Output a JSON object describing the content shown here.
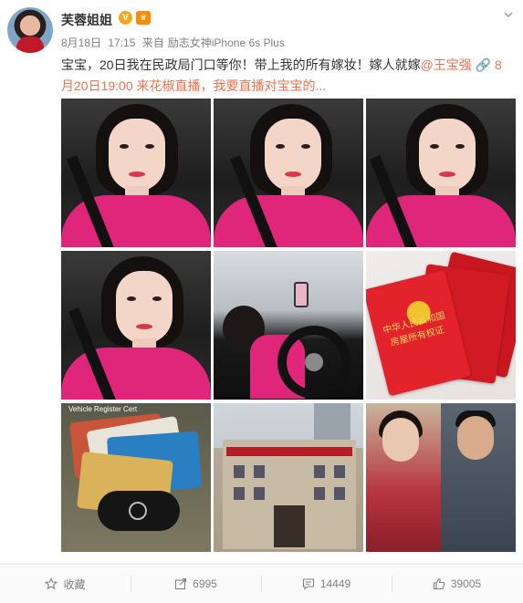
{
  "post": {
    "username": "芙蓉姐姐",
    "badge_v": "V",
    "badge_vip": "♛",
    "date": "8月18日",
    "time": "17:15",
    "source_prefix": "来自",
    "source": "励志女神iPhone 6s Plus",
    "text_part1": "宝宝，20日我在民政局门口等你！带上我的所有嫁妆！嫁人就嫁",
    "mention": "@王宝强",
    "link_icon": "🔗",
    "text_part2": "8月20日19:00 来花椒直播，我要直播对宝宝的",
    "more": "..."
  },
  "images": {
    "count": 9,
    "books_title": "中华人民共和国 房屋所有权证",
    "cards_caption": "Vehicle Register Cert"
  },
  "actions": {
    "favorite_label": "收藏",
    "repost_count": "6995",
    "comment_count": "14449",
    "like_count": "39005"
  },
  "icons": {
    "dropdown": "chevron-down-icon",
    "favorite": "star-icon",
    "repost": "share-icon",
    "comment": "comment-icon",
    "like": "thumbs-up-icon"
  },
  "colors": {
    "link": "#eb7350",
    "muted": "#808080",
    "text": "#333333"
  }
}
